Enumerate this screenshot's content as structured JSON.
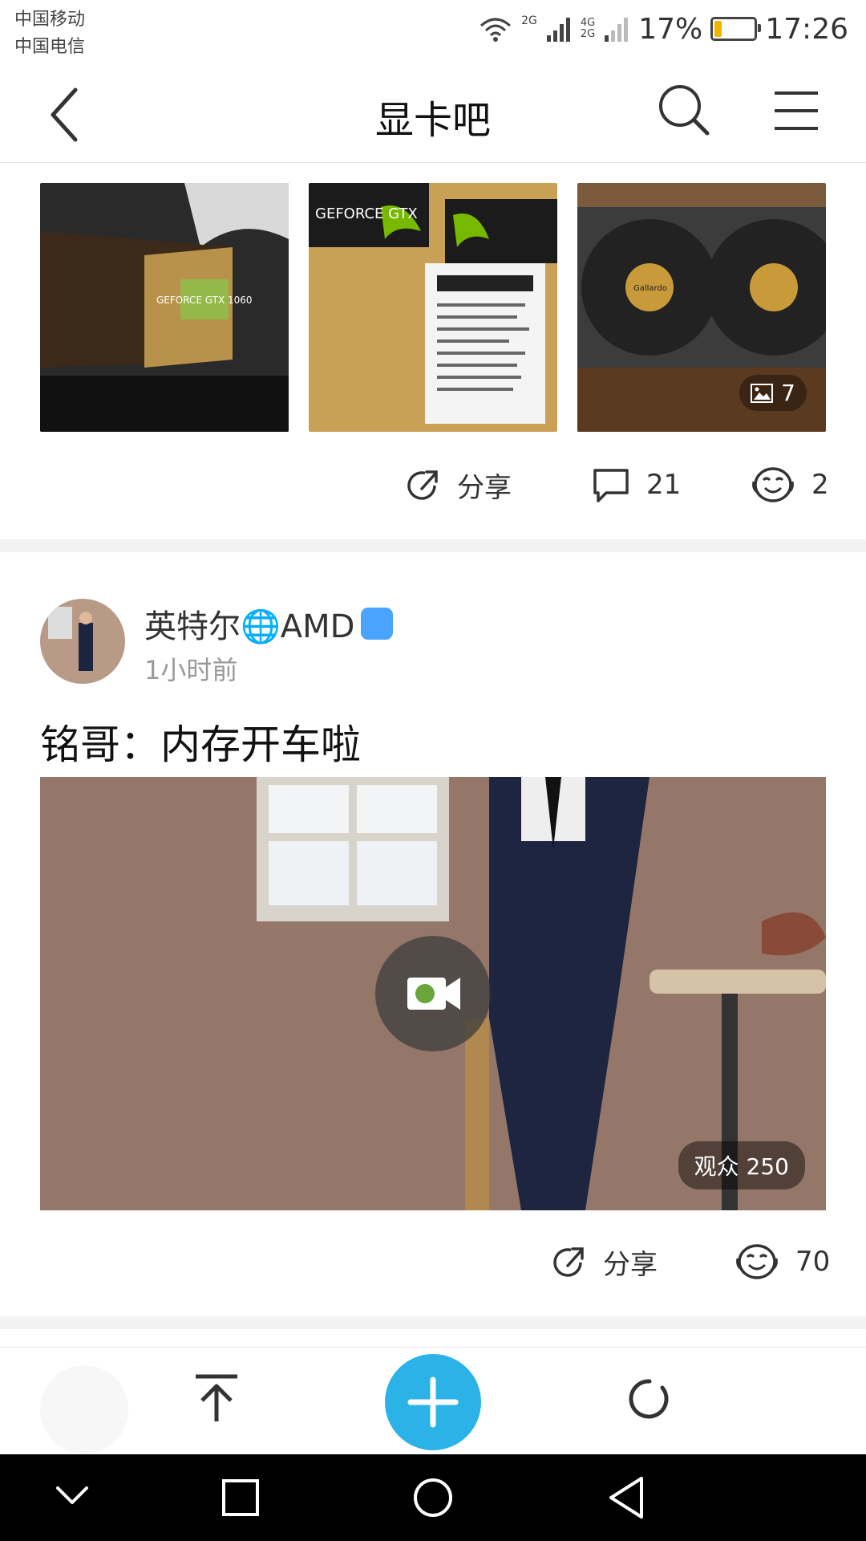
{
  "status_bar": {
    "carrier_1": "中国移动",
    "carrier_2": "中国电信",
    "network_1": "2G",
    "network_2": "4G",
    "network_2b": "2G",
    "battery": "17%",
    "battery_level": 0.17,
    "time": "17:26"
  },
  "nav": {
    "title": "显卡吧",
    "back_icon": "back-chevron-icon",
    "search_icon": "search-icon",
    "menu_icon": "menu-icon"
  },
  "post1": {
    "images": [
      {
        "caption": "GEFORCE GTX 1060"
      },
      {
        "caption": "GEFORCE GTX"
      },
      {
        "caption": "Gallardo"
      }
    ],
    "image_count": "7",
    "actions": {
      "share_label": "分享",
      "comments": "21",
      "likes": "2"
    }
  },
  "post2": {
    "username": "英特尔🌐AMD",
    "time": "1小时前",
    "title": "铭哥：内存开车啦",
    "viewers": "观众 250",
    "actions": {
      "share_label": "分享",
      "likes": "70"
    }
  },
  "colors": {
    "accent": "#2bb3e8",
    "badge": "#4aa3ff",
    "battery_fill": "#f1b400"
  }
}
